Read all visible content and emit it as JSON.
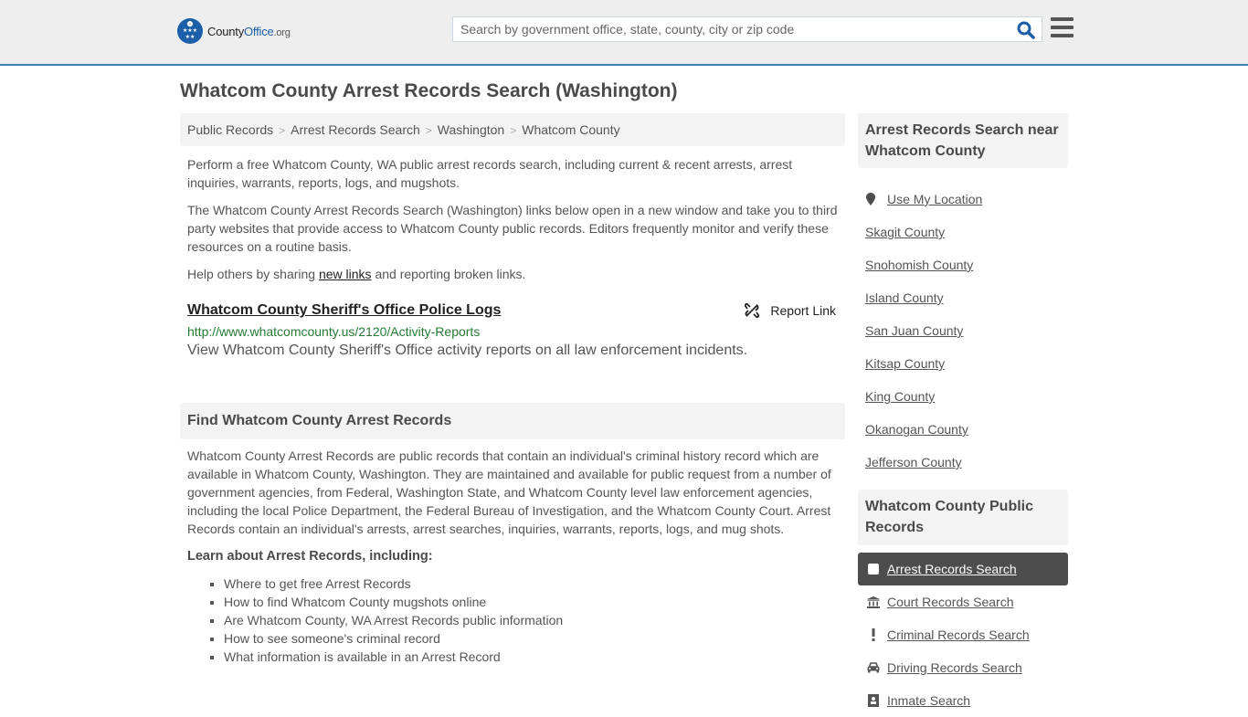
{
  "header": {
    "logo": {
      "county": "County",
      "office": "Office",
      "org": ".org"
    },
    "search": {
      "placeholder": "Search by government office, state, county, city or zip code",
      "value": ""
    },
    "colors": {
      "brand": "#1c5ea8",
      "border": "#3a7fb0"
    }
  },
  "page": {
    "title": "Whatcom County Arrest Records Search (Washington)",
    "breadcrumb": [
      "Public Records",
      "Arrest Records Search",
      "Washington",
      "Whatcom County"
    ],
    "intro": {
      "p1": "Perform a free Whatcom County, WA public arrest records search, including current & recent arrests, arrest inquiries, warrants, reports, logs, and mugshots.",
      "p2": "The Whatcom County Arrest Records Search (Washington) links below open in a new window and take you to third party websites that provide access to Whatcom County public records. Editors frequently monitor and verify these resources on a routine basis.",
      "p3_before": "Help others by sharing ",
      "p3_link": "new links",
      "p3_after": " and reporting broken links."
    },
    "result": {
      "title": "Whatcom County Sheriff's Office Police Logs",
      "report_label": "Report Link",
      "url": "http://www.whatcomcounty.us/2120/Activity-Reports",
      "description": "View Whatcom County Sheriff's Office activity reports on all law enforcement incidents."
    },
    "find_section": {
      "heading": "Find Whatcom County Arrest Records",
      "body": "Whatcom County Arrest Records are public records that contain an individual's criminal history record which are available in Whatcom County, Washington. They are maintained and available for public request from a number of government agencies, from Federal, Washington State, and Whatcom County level law enforcement agencies, including the local Police Department, the Federal Bureau of Investigation, and the Whatcom County Court. Arrest Records contain an individual's arrests, arrest searches, inquiries, warrants, reports, logs, and mug shots.",
      "learn_heading": "Learn about Arrest Records, including:",
      "learn_items": [
        "Where to get free Arrest Records",
        "How to find Whatcom County mugshots online",
        "Are Whatcom County, WA Arrest Records public information",
        "How to see someone's criminal record",
        "What information is available in an Arrest Record"
      ]
    }
  },
  "sidebar": {
    "near": {
      "heading": "Arrest Records Search near Whatcom County",
      "use_location": "Use My Location",
      "counties": [
        "Skagit County",
        "Snohomish County",
        "Island County",
        "San Juan County",
        "Kitsap County",
        "King County",
        "Okanogan County",
        "Jefferson County"
      ]
    },
    "public_records": {
      "heading": "Whatcom County Public Records",
      "items": [
        {
          "label": "Arrest Records Search",
          "icon": "square-icon",
          "active": true
        },
        {
          "label": "Court Records Search",
          "icon": "courthouse-icon",
          "active": false
        },
        {
          "label": "Criminal Records Search",
          "icon": "exclamation-icon",
          "active": false
        },
        {
          "label": "Driving Records Search",
          "icon": "car-icon",
          "active": false
        },
        {
          "label": "Inmate Search",
          "icon": "inmate-icon",
          "active": false
        }
      ]
    }
  }
}
